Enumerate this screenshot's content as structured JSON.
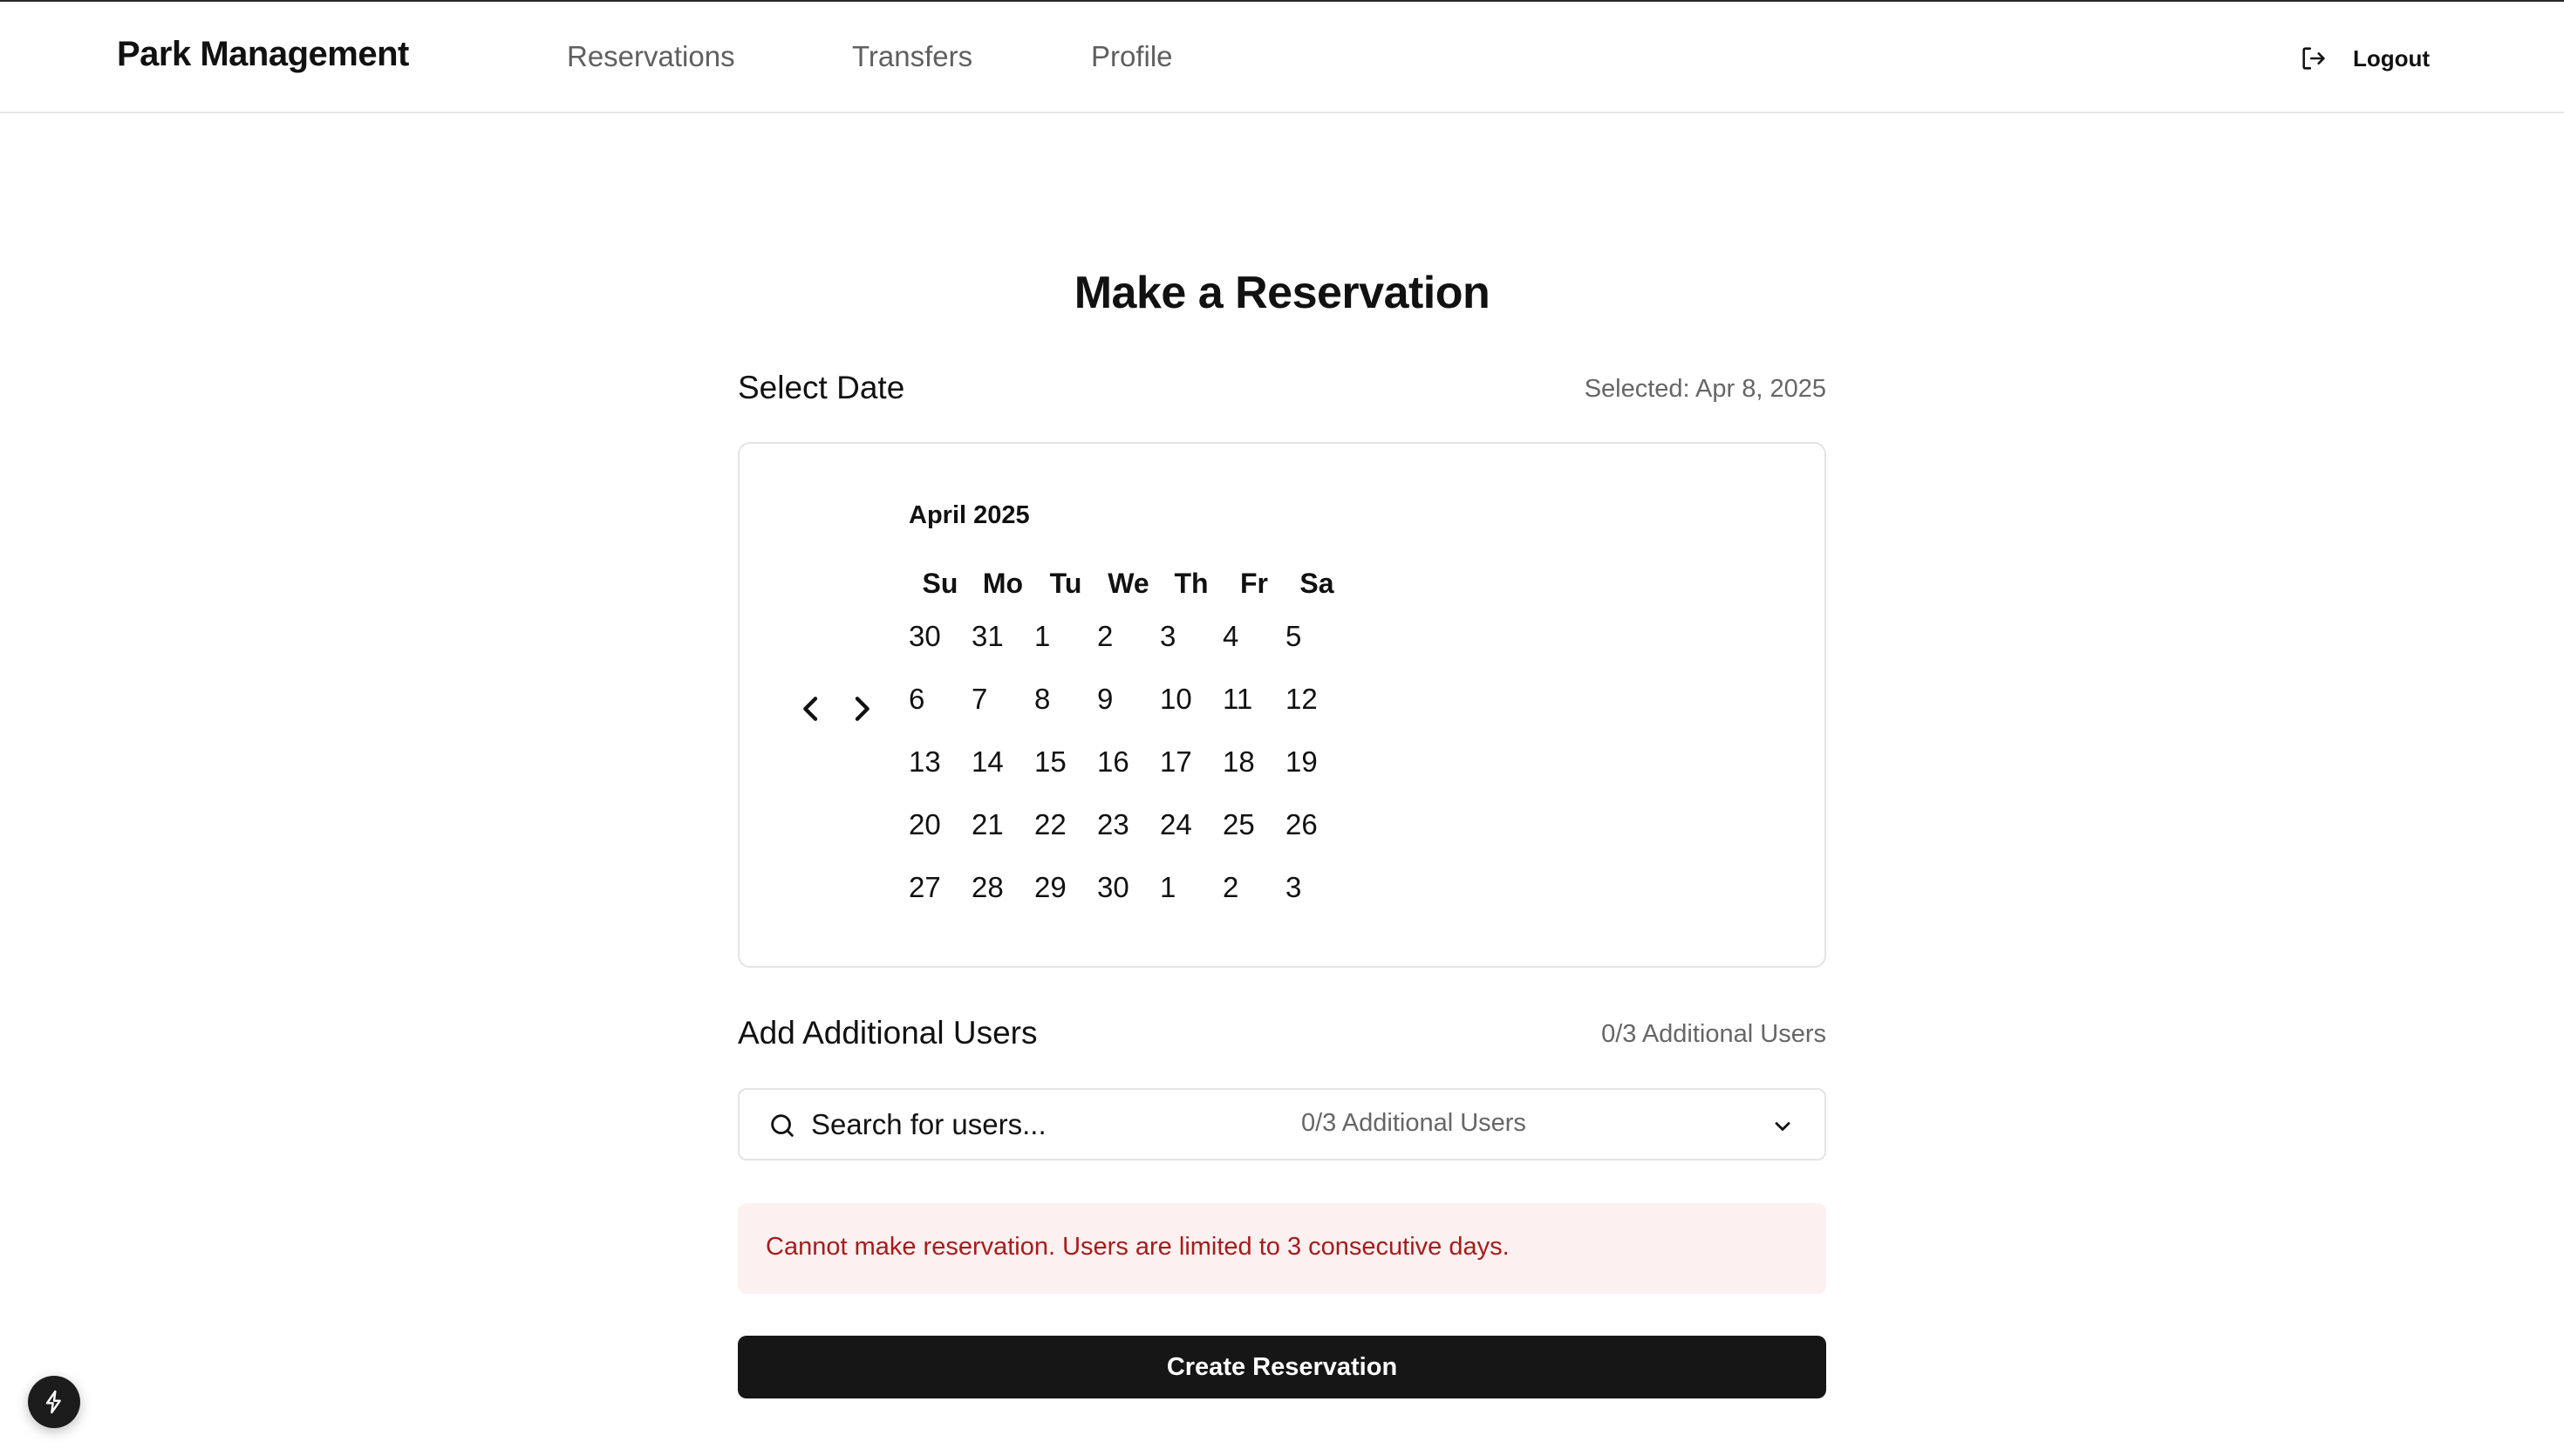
{
  "header": {
    "brand": "Park Management",
    "nav": [
      "Reservations",
      "Transfers",
      "Profile"
    ],
    "logout_label": "Logout",
    "logout_icon": "logout-icon"
  },
  "page": {
    "title": "Make a Reservation"
  },
  "date_section": {
    "title": "Select Date",
    "selected_text": "Selected: Apr 8, 2025",
    "calendar": {
      "month_label": "April 2025",
      "prev_icon": "chevron-left-icon",
      "next_icon": "chevron-right-icon",
      "weekdays": [
        "Su",
        "Mo",
        "Tu",
        "We",
        "Th",
        "Fr",
        "Sa"
      ],
      "weeks": [
        [
          "30",
          "31",
          "1",
          "2",
          "3",
          "4",
          "5"
        ],
        [
          "6",
          "7",
          "8",
          "9",
          "10",
          "11",
          "12"
        ],
        [
          "13",
          "14",
          "15",
          "16",
          "17",
          "18",
          "19"
        ],
        [
          "20",
          "21",
          "22",
          "23",
          "24",
          "25",
          "26"
        ],
        [
          "27",
          "28",
          "29",
          "30",
          "1",
          "2",
          "3"
        ]
      ]
    }
  },
  "users_section": {
    "title": "Add Additional Users",
    "count_text": "0/3 Additional Users",
    "search": {
      "placeholder": "Search for users...",
      "value": "",
      "count_text": "0/3 Additional Users",
      "search_icon": "search-icon",
      "dropdown_icon": "chevron-down-icon"
    }
  },
  "error": {
    "message": "Cannot make reservation. Users are limited to 3 consecutive days."
  },
  "actions": {
    "create_label": "Create Reservation"
  },
  "fab": {
    "icon": "lightning-bolt-icon"
  },
  "colors": {
    "error_bg": "#fcf0f0",
    "error_text": "#a51c1c",
    "primary_button": "#161616",
    "muted_text": "#666666"
  }
}
